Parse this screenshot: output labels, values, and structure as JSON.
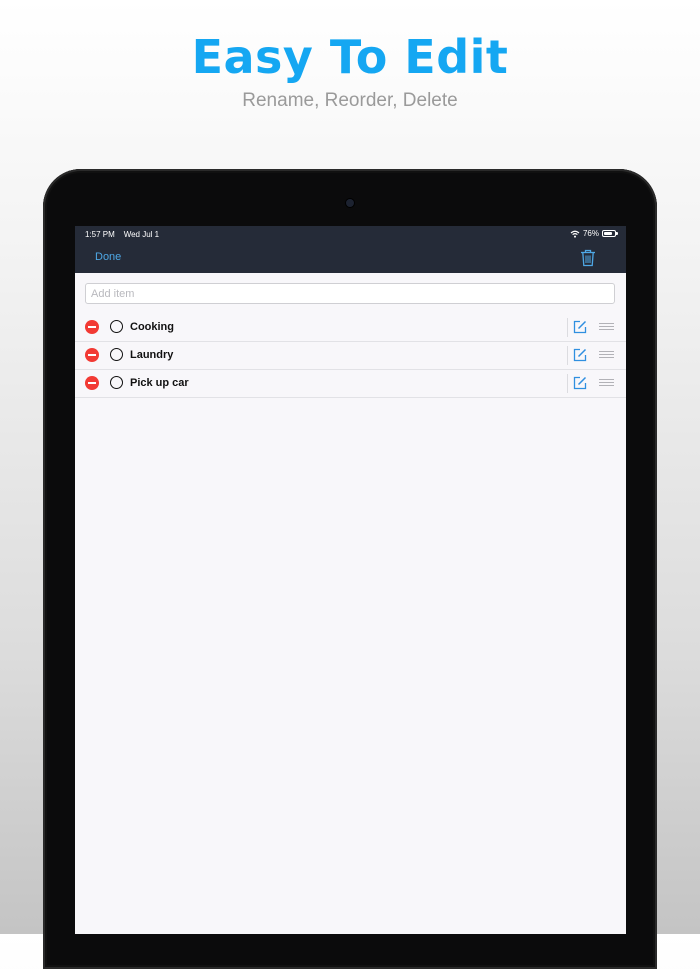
{
  "promo": {
    "title": "Easy To Edit",
    "subtitle": "Rename, Reorder, Delete"
  },
  "status_bar": {
    "time": "1:57 PM",
    "date": "Wed Jul 1",
    "battery_percent": "76%",
    "battery_level": 0.76
  },
  "nav": {
    "done_label": "Done",
    "trash_icon": "trash-icon"
  },
  "add_item": {
    "placeholder": "Add item",
    "value": ""
  },
  "items": [
    {
      "label": "Cooking"
    },
    {
      "label": "Laundry"
    },
    {
      "label": "Pick up car"
    }
  ],
  "colors": {
    "accent": "#15a7f2",
    "nav_background": "#252b38",
    "nav_link": "#4ea8e6",
    "delete_red": "#f23a34",
    "edit_blue": "#2f8fe0"
  }
}
